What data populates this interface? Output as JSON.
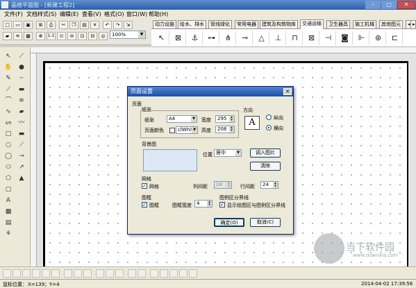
{
  "window": {
    "title": "晶络平面图 - [新建工程2]",
    "min": "–",
    "max": "□",
    "close": "✕"
  },
  "menu": [
    "文件(F)",
    "文档样式(S)",
    "编辑(E)",
    "查看(V)",
    "格式(O)",
    "窗口(W)",
    "帮助(H)"
  ],
  "toolbar": {
    "zoom_value": "100%",
    "actual_size_label": "1:1"
  },
  "category_tabs": [
    "动力设施",
    "给水、排水",
    "管线绿化",
    "常用电器",
    "建筑及构筑物库",
    "交通运输",
    "卫生器具",
    "施工机械",
    "其他图元"
  ],
  "active_tab": "交通运输",
  "dialog": {
    "title": "页面设置",
    "close": "✕",
    "page_group": "页面",
    "paper_group": "纸张",
    "paper_label": "纸张",
    "paper_value": "A4",
    "page_color_label": "页面颜色",
    "page_color_value": "clWhit",
    "width_label": "宽度",
    "width_value": "295",
    "height_label": "高度",
    "height_value": "208",
    "orientation_group": "方向",
    "portrait_label": "纵向",
    "landscape_label": "横向",
    "orientation_icon": "A",
    "bg_group": "背景图",
    "position_label": "位置",
    "position_value": "居中",
    "import_button": "调入图片",
    "clear_button": "清除",
    "grid_group": "网格",
    "grid_check_label": "网格",
    "col_spacing_label": "列间距",
    "col_spacing_value": "24",
    "row_spacing_label": "行间距",
    "row_spacing_value": "24",
    "frame_group": "图框",
    "frame_check_label": "图框",
    "frame_width_label": "图框宽度",
    "frame_width_value": "4",
    "boundary_group": "图例区分界线",
    "boundary_check_label": "显示绘图区与图例区分界线",
    "ok_button": "确定(O)",
    "cancel_button": "取消(C)"
  },
  "status": {
    "position_label": "鼠标位置：",
    "position_value": "X=139；Y=4",
    "datetime": "2014-04-02  17:39:56"
  },
  "watermark": {
    "text": "当下软件园",
    "url": "www.downxia.com"
  }
}
